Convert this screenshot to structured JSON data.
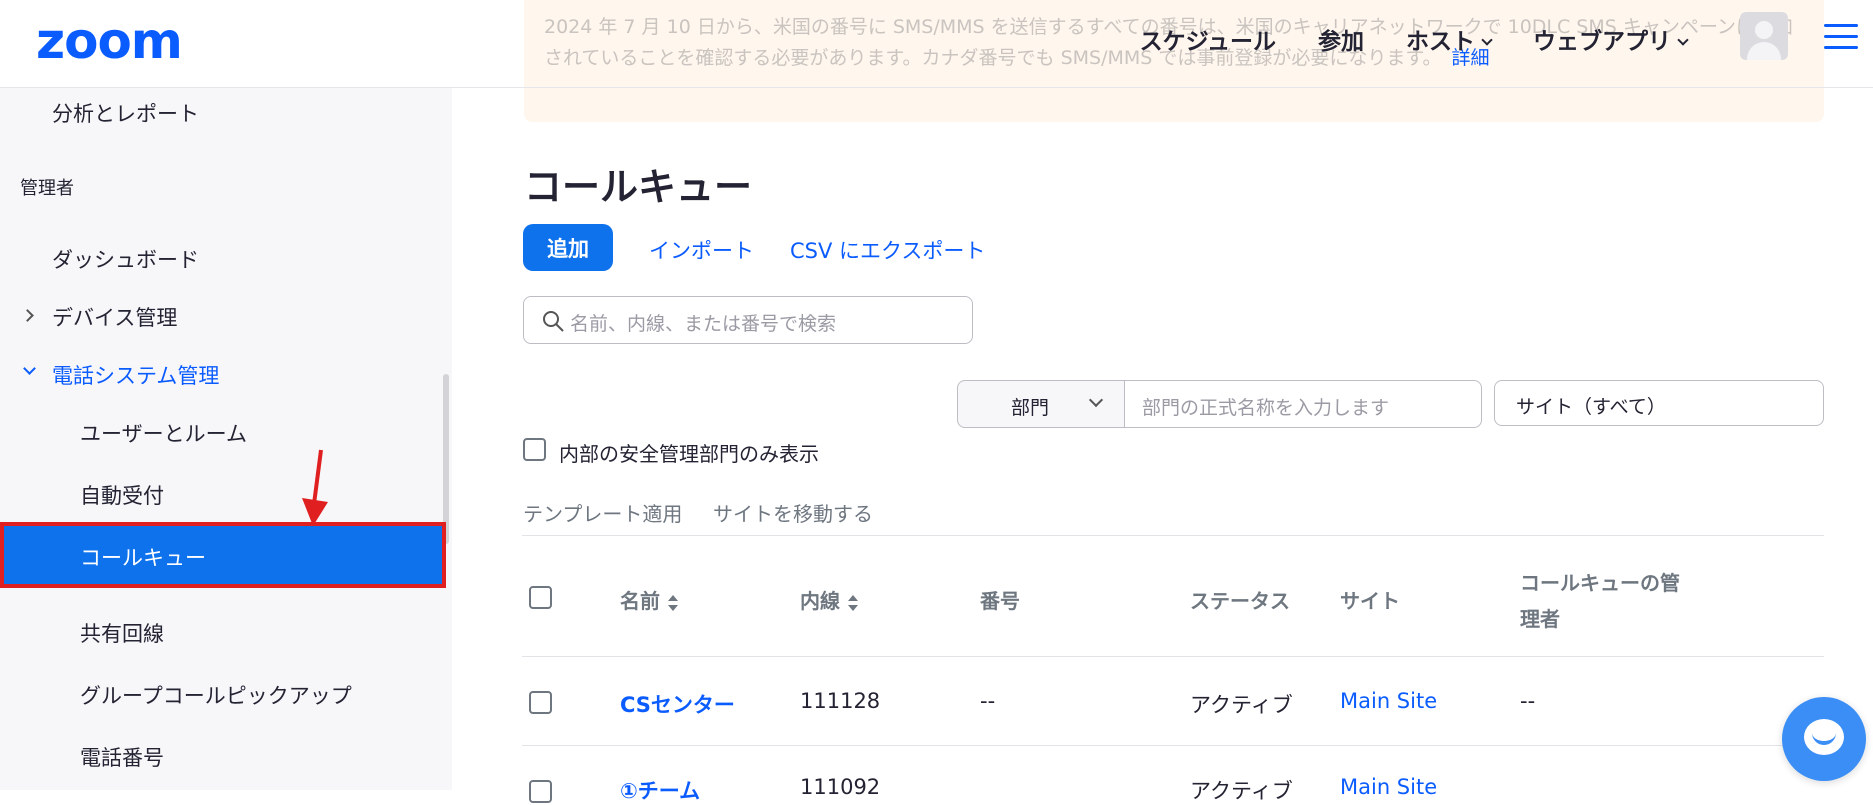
{
  "header": {
    "logo": "zoom",
    "nav": [
      "スケジュール",
      "参加",
      "ホスト",
      "ウェブアプリ"
    ]
  },
  "banner": {
    "text": "2024 年 7 月 10 日から、米国の番号に SMS/MMS を送信するすべての番号は、米国のキャリアネットワークで 10DLC SMS キャンペーンに追加されていることを確認する必要があります。カナダ番号でも SMS/MMS では事前登録が必要になります。",
    "link": "詳細"
  },
  "sidebar": {
    "top_item": "分析とレポート",
    "section": "管理者",
    "dashboard": "ダッシュボード",
    "device_mgmt": "デバイス管理",
    "phone_system": "電話システム管理",
    "sub_items": [
      "ユーザーとルーム",
      "自動受付",
      "コールキュー",
      "共有回線",
      "グループコールピックアップ",
      "電話番号"
    ],
    "active": "コールキュー"
  },
  "main": {
    "title": "コールキュー",
    "add_button": "追加",
    "import_link": "インポート",
    "export_link": "CSV にエクスポート",
    "search_placeholder": "名前、内線、または番号で検索",
    "dept_select": "部門",
    "dept_placeholder": "部門の正式名称を入力します",
    "site_select": "サイト（すべて）",
    "checkbox_label": "内部の安全管理部門のみ表示",
    "action_template": "テンプレート適用",
    "action_move": "サイトを移動する",
    "table": {
      "headers": [
        "名前",
        "内線",
        "番号",
        "ステータス",
        "サイト",
        "コールキューの管",
        "理者"
      ],
      "rows": [
        {
          "name": "CSセンター",
          "ext": "111128",
          "number": "--",
          "status": "アクティブ",
          "site": "Main Site",
          "manager": "--"
        },
        {
          "name": "①チーム",
          "ext": "111092",
          "number": "",
          "status": "アクティブ",
          "site": "Main Site",
          "manager": ""
        }
      ]
    }
  },
  "colors": {
    "brand": "#0b5cff",
    "active_bg": "#0e72ed",
    "highlight_border": "#e02020"
  }
}
